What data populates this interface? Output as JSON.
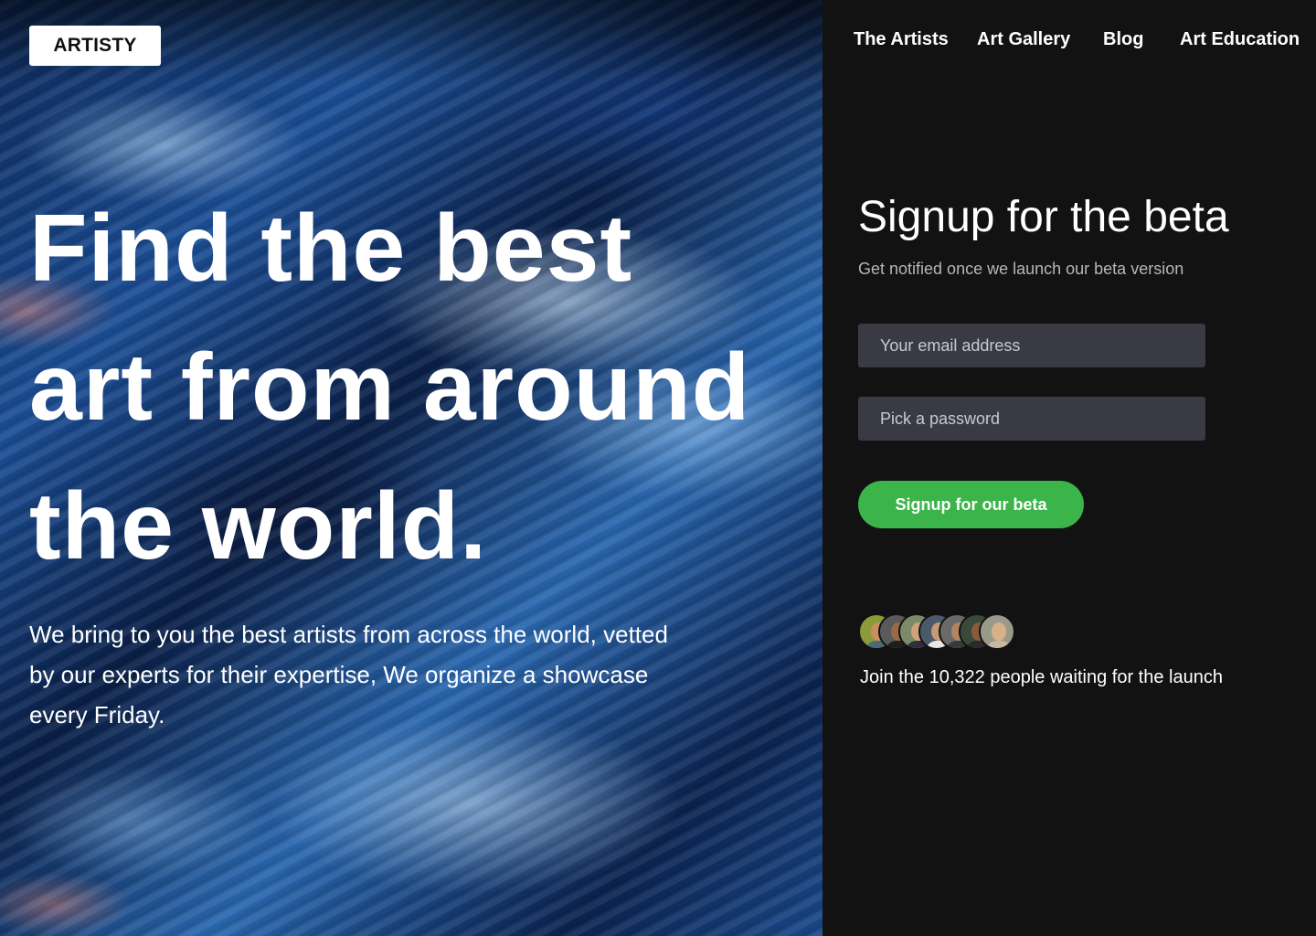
{
  "brand": {
    "logo_text": "ARTISTY"
  },
  "nav": {
    "items": [
      {
        "label": "The Artists"
      },
      {
        "label": "Art Gallery"
      },
      {
        "label": "Blog"
      },
      {
        "label": "Art Education"
      }
    ]
  },
  "hero": {
    "headline_lines": [
      "Find the best",
      "art from around",
      "the world."
    ],
    "description": "We bring to you the best artists from across the world, vetted by our experts for their expertise, We organize a showcase every Friday."
  },
  "signup": {
    "title": "Signup for the beta",
    "subtitle": "Get notified once we launch our beta version",
    "email_placeholder": "Your email address",
    "password_placeholder": "Pick a password",
    "button_label": "Signup for our beta",
    "waiting_text": "Join the 10,322 people waiting for the launch",
    "avatar_count": 7
  },
  "colors": {
    "page_background": "#121212",
    "input_background": "#3a3a44",
    "button_green": "#3bb54a",
    "subtitle_gray": "#b6b6b6"
  }
}
